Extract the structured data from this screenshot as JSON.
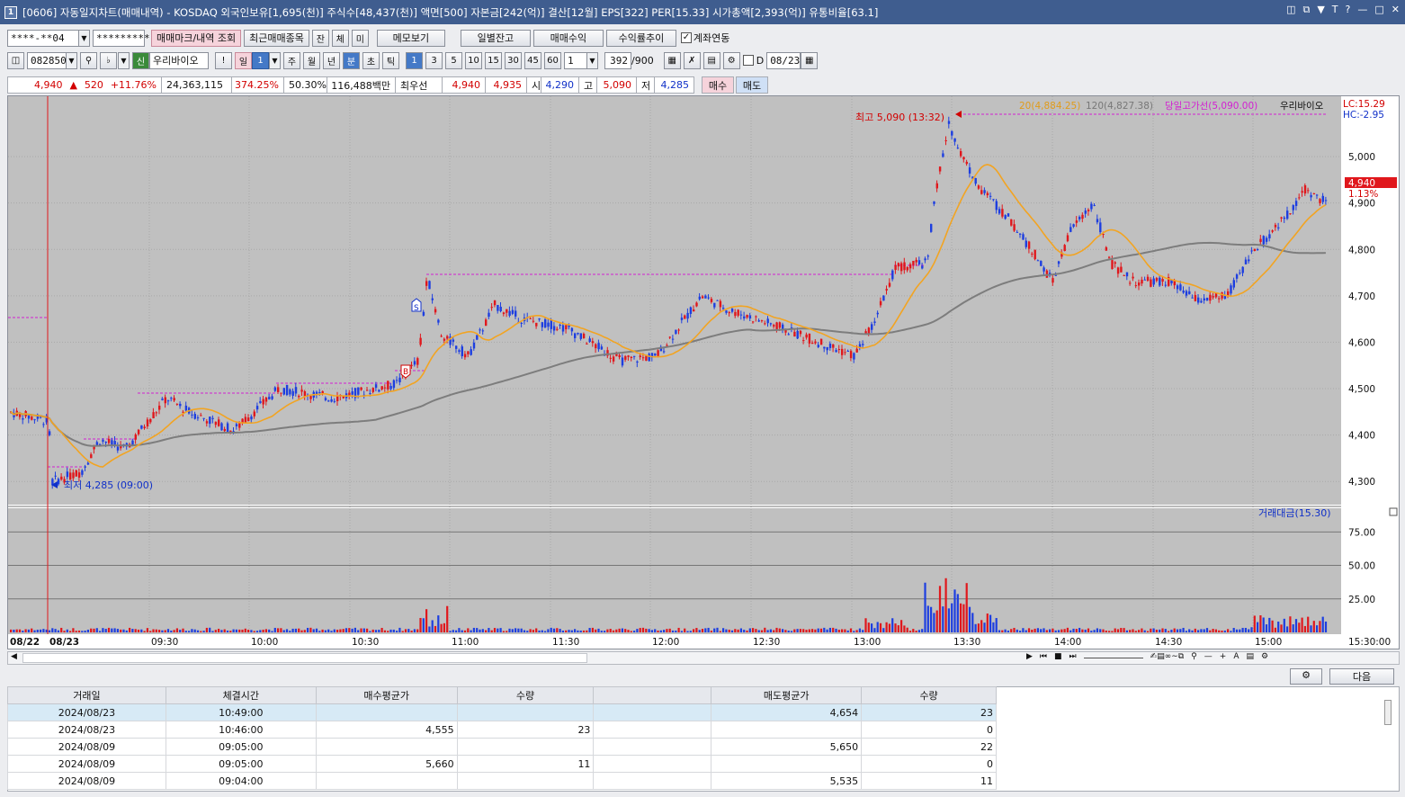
{
  "window": {
    "title": "[0606] 자동일지차트(매매내역) - KOSDAQ 외국인보유[1,695(천)] 주식수[48,437(천)] 액면[500] 자본금[242(억)] 결산[12월] EPS[322] PER[15.33] 시가총액[2,393(억)] 유통비율[63.1]",
    "icon_text": "1"
  },
  "toolbar1": {
    "account": "****-**04",
    "password": "*********",
    "btn_mark": "매매마크/내역 조회",
    "btn_recent": "최근매매종목",
    "btn_jan": "잔",
    "btn_che": "체",
    "btn_mi": "미",
    "btn_memo": "메모보기",
    "btn_daily": "일별잔고",
    "btn_profit": "매매수익",
    "btn_rate": "수익률추이",
    "chk_link": "계좌연동"
  },
  "toolbar2": {
    "code": "082850",
    "sin": "신",
    "name": "우리바이오",
    "excl": "!",
    "periods": [
      "일",
      "1",
      "주",
      "월",
      "년",
      "분",
      "초",
      "틱"
    ],
    "minutes": [
      "1",
      "3",
      "5",
      "10",
      "15",
      "30",
      "45",
      "60"
    ],
    "mult": "1",
    "count": "392",
    "countmax": "/900",
    "d_label": "D",
    "date": "08/23"
  },
  "quote": {
    "price": "4,940",
    "change_arrow": "▲",
    "change": "520",
    "pct": "+11.76%",
    "volume": "24,363,115",
    "vol_ratio": "374.25%",
    "turnover": "50.30%",
    "amount": "116,488백만",
    "best_label": "최우선",
    "best_ask": "4,940",
    "best_bid": "4,935",
    "open_label": "시",
    "open": "4,290",
    "high_label": "고",
    "high": "5,090",
    "low_label": "저",
    "low": "4,285",
    "buy": "매수",
    "sell": "매도"
  },
  "chart": {
    "legend": {
      "ma20": "20(4,884.25)",
      "ma120": "120(4,827.38)",
      "high_line": "당일고가선(5,090.00)",
      "stock_name": "우리바이오",
      "lc": "LC:15.29",
      "hc": "HC:-2.95"
    },
    "high_note": "최고 5,090 (13:32)",
    "low_note": "최저 4,285 (09:00)",
    "price_ticks": [
      "5,000",
      "4,900",
      "4,800",
      "4,700",
      "4,600",
      "4,500",
      "4,400",
      "4,300"
    ],
    "current_price": "4,940",
    "current_pct": "1.13%",
    "vol_legend": "거래대금(15.30)",
    "vol_ticks": [
      "75.00",
      "50.00",
      "25.00"
    ],
    "time_labels": [
      "08/22",
      "08/23",
      "09:30",
      "10:00",
      "10:30",
      "11:00",
      "11:30",
      "12:00",
      "12:30",
      "13:00",
      "13:30",
      "14:00",
      "14:30",
      "15:00",
      "15:30:00"
    ],
    "marks": {
      "buy": "B",
      "sell": "S"
    },
    "colors": {
      "up": "#e0171c",
      "down": "#1d3ee0",
      "ma20": "#f2a422",
      "ma120": "#7d7d7d",
      "bg": "#c0c0c0"
    }
  },
  "chart_data": {
    "type": "candlestick",
    "ylim": [
      4250,
      5130
    ],
    "high": 5090,
    "low": 4285,
    "open": 4290,
    "current": 4940,
    "ma20": 4884.25,
    "ma120": 4827.38
  },
  "grid": {
    "headers": [
      "거래일",
      "체결시간",
      "매수평균가",
      "수량",
      "",
      "매도평균가",
      "수량"
    ],
    "rows": [
      [
        "2024/08/23",
        "10:49:00",
        "",
        "",
        "",
        "4,654",
        "23"
      ],
      [
        "2024/08/23",
        "10:46:00",
        "4,555",
        "23",
        "",
        "",
        "0"
      ],
      [
        "2024/08/09",
        "09:05:00",
        "",
        "",
        "",
        "5,650",
        "22"
      ],
      [
        "2024/08/09",
        "09:05:00",
        "5,660",
        "11",
        "",
        "",
        "0"
      ],
      [
        "2024/08/09",
        "09:04:00",
        "",
        "",
        "",
        "5,535",
        "11"
      ]
    ],
    "next": "다음"
  }
}
